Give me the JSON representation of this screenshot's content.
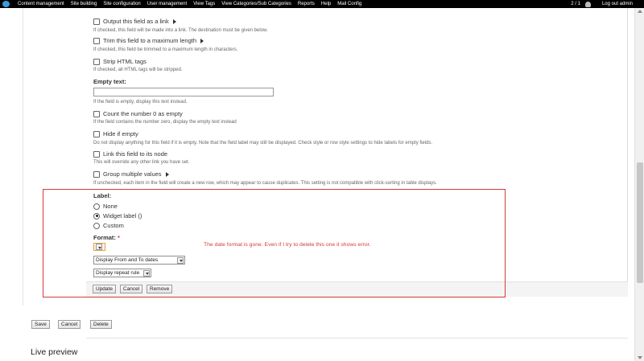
{
  "toolbar": {
    "menu": [
      "Content management",
      "Site building",
      "Site configuration",
      "User management",
      "View Tags",
      "View Categories/Sub Categories",
      "Reports",
      "Help",
      "Mail Config"
    ],
    "user_count": "2 / 1",
    "logout": "Log out admin"
  },
  "options": [
    {
      "label": "Output this field as a link",
      "checked": false,
      "expandable": true,
      "desc": "If checked, this field will be made into a link. The destination must be given below."
    },
    {
      "label": "Trim this field to a maximum length",
      "checked": false,
      "expandable": true,
      "desc": "If checked, this field be trimmed to a maximum length in characters."
    },
    {
      "label": "Strip HTML tags",
      "checked": false,
      "expandable": false,
      "desc": "If checked, all HTML tags will be stripped."
    }
  ],
  "empty_text": {
    "label": "Empty text:",
    "value": "",
    "desc": "If the field is empty, display this text instead."
  },
  "options2": [
    {
      "label": "Count the number 0 as empty",
      "checked": false,
      "expandable": false,
      "desc": "If the field contains the number zero, display the empty text instead"
    },
    {
      "label": "Hide if empty",
      "checked": false,
      "expandable": false,
      "desc": "Do not display anything for this field if it is empty. Note that the field label may still be displayed. Check style or row style settings to hide labels for empty fields."
    },
    {
      "label": "Link this field to its node",
      "checked": false,
      "expandable": false,
      "desc": "This will override any other link you have set."
    },
    {
      "label": "Group multiple values",
      "checked": false,
      "expandable": true,
      "desc": "If unchecked, each item in the field will create a new row, which may appear to cause duplicates. This setting is not compatible with click-sorting in table displays."
    }
  ],
  "label_section": {
    "title": "Label:",
    "radios": [
      {
        "label": "None",
        "selected": false
      },
      {
        "label": "Widget label ()",
        "selected": true
      },
      {
        "label": "Custom",
        "selected": false
      }
    ]
  },
  "format": {
    "title": "Format:",
    "required_mark": "*",
    "selected": "",
    "fromto_select": "Display From and To dates",
    "repeat_select": "Display repeat rule"
  },
  "field_buttons": {
    "update": "Update",
    "cancel": "Cancel",
    "remove": "Remove"
  },
  "annotation": "The date format is gone. Even if I try to delete this one it shows error.",
  "page_buttons": {
    "save": "Save",
    "cancel": "Cancel",
    "delete": "Delete"
  },
  "live_preview": "Live preview",
  "colors": {
    "toolbar": "#000000",
    "annotation": "#d63a3a",
    "required": "#e03b3b"
  }
}
